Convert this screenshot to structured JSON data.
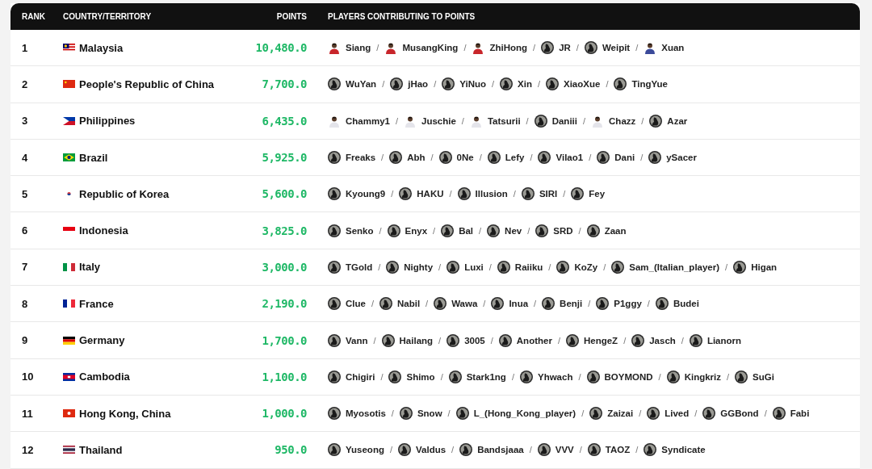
{
  "table": {
    "separator": "/",
    "columns": [
      "RANK",
      "COUNTRY/TERRITORY",
      "POINTS",
      "PLAYERS CONTRIBUTING TO POINTS"
    ],
    "rows": [
      {
        "rank": "1",
        "flag": {
          "kind": "malaysia"
        },
        "country": "Malaysia",
        "points": "10,480.0",
        "players": [
          {
            "name": "Siang",
            "avatar": {
              "kind": "photo",
              "color": "#c8262b"
            }
          },
          {
            "name": "MusangKing",
            "avatar": {
              "kind": "photo",
              "color": "#c8262b"
            }
          },
          {
            "name": "ZhiHong",
            "avatar": {
              "kind": "photo",
              "color": "#c8262b"
            }
          },
          {
            "name": "JR",
            "avatar": {
              "kind": "default"
            }
          },
          {
            "name": "Weipit",
            "avatar": {
              "kind": "default"
            }
          },
          {
            "name": "Xuan",
            "avatar": {
              "kind": "photo",
              "color": "#3b4a9a"
            }
          }
        ]
      },
      {
        "rank": "2",
        "flag": {
          "kind": "china"
        },
        "country": "People's Republic of China",
        "points": "7,700.0",
        "players": [
          {
            "name": "WuYan",
            "avatar": {
              "kind": "default"
            }
          },
          {
            "name": "jHao",
            "avatar": {
              "kind": "default"
            }
          },
          {
            "name": "YiNuo",
            "avatar": {
              "kind": "default"
            }
          },
          {
            "name": "Xin",
            "avatar": {
              "kind": "default"
            }
          },
          {
            "name": "XiaoXue",
            "avatar": {
              "kind": "default"
            }
          },
          {
            "name": "TingYue",
            "avatar": {
              "kind": "default"
            }
          }
        ]
      },
      {
        "rank": "3",
        "flag": {
          "kind": "philippines"
        },
        "country": "Philippines",
        "points": "6,435.0",
        "players": [
          {
            "name": "Chammy1",
            "avatar": {
              "kind": "photo",
              "color": "#e4e4ea"
            }
          },
          {
            "name": "Juschie",
            "avatar": {
              "kind": "photo",
              "color": "#e4e4ea"
            }
          },
          {
            "name": "Tatsurii",
            "avatar": {
              "kind": "photo",
              "color": "#e4e4ea"
            }
          },
          {
            "name": "Daniii",
            "avatar": {
              "kind": "default"
            }
          },
          {
            "name": "Chazz",
            "avatar": {
              "kind": "photo",
              "color": "#e4e4ea"
            }
          },
          {
            "name": "Azar",
            "avatar": {
              "kind": "default"
            }
          }
        ]
      },
      {
        "rank": "4",
        "flag": {
          "kind": "brazil"
        },
        "country": "Brazil",
        "points": "5,925.0",
        "players": [
          {
            "name": "Freaks",
            "avatar": {
              "kind": "default"
            }
          },
          {
            "name": "Abh",
            "avatar": {
              "kind": "default"
            }
          },
          {
            "name": "0Ne",
            "avatar": {
              "kind": "default"
            }
          },
          {
            "name": "Lefy",
            "avatar": {
              "kind": "default"
            }
          },
          {
            "name": "Vilao1",
            "avatar": {
              "kind": "default"
            }
          },
          {
            "name": "Dani",
            "avatar": {
              "kind": "default"
            }
          },
          {
            "name": "ySacer",
            "avatar": {
              "kind": "default"
            }
          }
        ]
      },
      {
        "rank": "5",
        "flag": {
          "kind": "korea"
        },
        "country": "Republic of Korea",
        "points": "5,600.0",
        "players": [
          {
            "name": "Kyoung9",
            "avatar": {
              "kind": "default"
            }
          },
          {
            "name": "HAKU",
            "avatar": {
              "kind": "default"
            }
          },
          {
            "name": "Illusion",
            "avatar": {
              "kind": "default"
            }
          },
          {
            "name": "SIRI",
            "avatar": {
              "kind": "default"
            }
          },
          {
            "name": "Fey",
            "avatar": {
              "kind": "default"
            }
          }
        ]
      },
      {
        "rank": "6",
        "flag": {
          "kind": "indonesia"
        },
        "country": "Indonesia",
        "points": "3,825.0",
        "players": [
          {
            "name": "Senko",
            "avatar": {
              "kind": "default"
            }
          },
          {
            "name": "Enyx",
            "avatar": {
              "kind": "default"
            }
          },
          {
            "name": "Bal",
            "avatar": {
              "kind": "default"
            }
          },
          {
            "name": "Nev",
            "avatar": {
              "kind": "default"
            }
          },
          {
            "name": "SRD",
            "avatar": {
              "kind": "default"
            }
          },
          {
            "name": "Zaan",
            "avatar": {
              "kind": "default"
            }
          }
        ]
      },
      {
        "rank": "7",
        "flag": {
          "kind": "italy"
        },
        "country": "Italy",
        "points": "3,000.0",
        "players": [
          {
            "name": "TGold",
            "avatar": {
              "kind": "default"
            }
          },
          {
            "name": "Nighty",
            "avatar": {
              "kind": "default"
            }
          },
          {
            "name": "Luxi",
            "avatar": {
              "kind": "default"
            }
          },
          {
            "name": "Raiiku",
            "avatar": {
              "kind": "default"
            }
          },
          {
            "name": "KoZy",
            "avatar": {
              "kind": "default"
            }
          },
          {
            "name": "Sam_(Italian_player)",
            "avatar": {
              "kind": "default"
            }
          },
          {
            "name": "Higan",
            "avatar": {
              "kind": "default"
            }
          }
        ]
      },
      {
        "rank": "8",
        "flag": {
          "kind": "france"
        },
        "country": "France",
        "points": "2,190.0",
        "players": [
          {
            "name": "Clue",
            "avatar": {
              "kind": "default"
            }
          },
          {
            "name": "Nabil",
            "avatar": {
              "kind": "default"
            }
          },
          {
            "name": "Wawa",
            "avatar": {
              "kind": "default"
            }
          },
          {
            "name": "Inua",
            "avatar": {
              "kind": "default"
            }
          },
          {
            "name": "Benji",
            "avatar": {
              "kind": "default"
            }
          },
          {
            "name": "P1ggy",
            "avatar": {
              "kind": "default"
            }
          },
          {
            "name": "Budei",
            "avatar": {
              "kind": "default"
            }
          }
        ]
      },
      {
        "rank": "9",
        "flag": {
          "kind": "germany"
        },
        "country": "Germany",
        "points": "1,700.0",
        "players": [
          {
            "name": "Vann",
            "avatar": {
              "kind": "default"
            }
          },
          {
            "name": "Hailang",
            "avatar": {
              "kind": "default"
            }
          },
          {
            "name": "3005",
            "avatar": {
              "kind": "default"
            }
          },
          {
            "name": "Another",
            "avatar": {
              "kind": "default"
            }
          },
          {
            "name": "HengeZ",
            "avatar": {
              "kind": "default"
            }
          },
          {
            "name": "Jasch",
            "avatar": {
              "kind": "default"
            }
          },
          {
            "name": "Lianorn",
            "avatar": {
              "kind": "default"
            }
          }
        ]
      },
      {
        "rank": "10",
        "flag": {
          "kind": "cambodia"
        },
        "country": "Cambodia",
        "points": "1,100.0",
        "players": [
          {
            "name": "Chigiri",
            "avatar": {
              "kind": "default"
            }
          },
          {
            "name": "Shimo",
            "avatar": {
              "kind": "default"
            }
          },
          {
            "name": "Stark1ng",
            "avatar": {
              "kind": "default"
            }
          },
          {
            "name": "Yhwach",
            "avatar": {
              "kind": "default"
            }
          },
          {
            "name": "BOYMOND",
            "avatar": {
              "kind": "default"
            }
          },
          {
            "name": "Kingkriz",
            "avatar": {
              "kind": "default"
            }
          },
          {
            "name": "SuGi",
            "avatar": {
              "kind": "default"
            }
          }
        ]
      },
      {
        "rank": "11",
        "flag": {
          "kind": "hongkong"
        },
        "country": "Hong Kong, China",
        "points": "1,000.0",
        "players": [
          {
            "name": "Myosotis",
            "avatar": {
              "kind": "default"
            }
          },
          {
            "name": "Snow",
            "avatar": {
              "kind": "default"
            }
          },
          {
            "name": "L_(Hong_Kong_player)",
            "avatar": {
              "kind": "default"
            }
          },
          {
            "name": "Zaizai",
            "avatar": {
              "kind": "default"
            }
          },
          {
            "name": "Lived",
            "avatar": {
              "kind": "default"
            }
          },
          {
            "name": "GGBond",
            "avatar": {
              "kind": "default"
            }
          },
          {
            "name": "Fabi",
            "avatar": {
              "kind": "default"
            }
          }
        ]
      },
      {
        "rank": "12",
        "flag": {
          "kind": "thailand"
        },
        "country": "Thailand",
        "points": "950.0",
        "players": [
          {
            "name": "Yuseong",
            "avatar": {
              "kind": "default"
            }
          },
          {
            "name": "Valdus",
            "avatar": {
              "kind": "default"
            }
          },
          {
            "name": "Bandsjaaa",
            "avatar": {
              "kind": "default"
            }
          },
          {
            "name": "VVV",
            "avatar": {
              "kind": "default"
            }
          },
          {
            "name": "TAOZ",
            "avatar": {
              "kind": "default"
            }
          },
          {
            "name": "Syndicate",
            "avatar": {
              "kind": "default"
            }
          }
        ]
      }
    ]
  }
}
